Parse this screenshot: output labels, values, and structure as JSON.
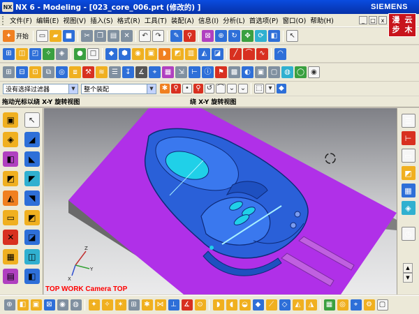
{
  "titlebar": {
    "app_badge": "NX",
    "title": "NX 6 - Modeling - [023_core_006.prt (修改的) ]",
    "brand": "SIEMENS"
  },
  "watermark": [
    "漫",
    "云",
    "步",
    "木"
  ],
  "menu": [
    "文件(F)",
    "编辑(E)",
    "视图(V)",
    "插入(S)",
    "格式(R)",
    "工具(T)",
    "装配(A)",
    "信息(I)",
    "分析(L)",
    "首选项(P)",
    "窗口(O)",
    "帮助(H)"
  ],
  "window_controls": {
    "minimize": "_",
    "restore": "□",
    "close": "x"
  },
  "toolbar1": {
    "start_label": "开始"
  },
  "selection": {
    "filter_value": "没有选择过滤器",
    "scope_value": "整个装配"
  },
  "cue_line": {
    "left": "拖动光标以绕 X-Y 旋转视图",
    "right": "绕 X-Y 旋转视图"
  },
  "viewport": {
    "view_label": "TOP WORK Camera TOP",
    "axes": {
      "x": "X",
      "y": "Y",
      "z": "Z"
    }
  },
  "colors": {
    "titlebar": "#0a4ce0",
    "workpiece_magenta": "#b030e8",
    "part_blue": "#2a60d8",
    "highlight_cyan": "#20d0e8",
    "base_gray": "#808080"
  }
}
